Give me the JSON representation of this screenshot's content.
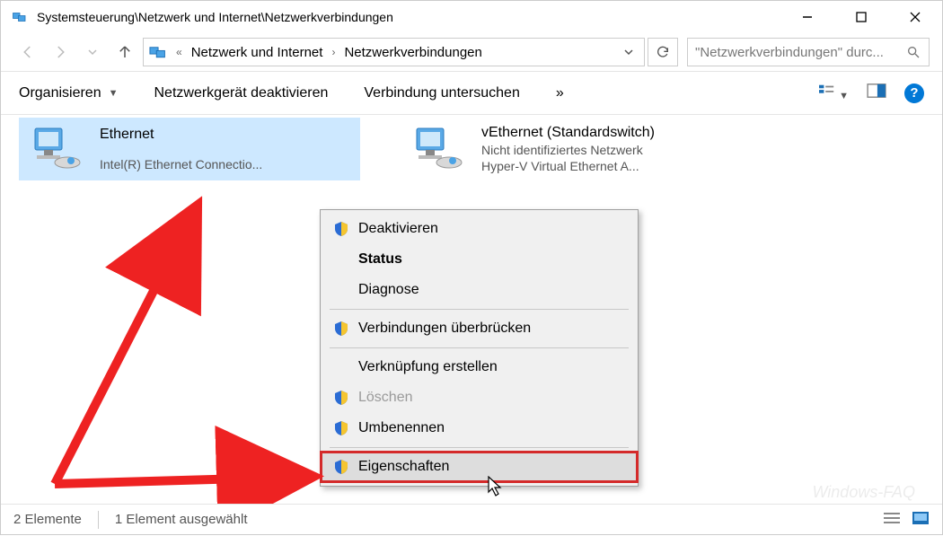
{
  "window": {
    "title": "Systemsteuerung\\Netzwerk und Internet\\Netzwerkverbindungen"
  },
  "breadcrumb": {
    "seg1": "Netzwerk und Internet",
    "seg2": "Netzwerkverbindungen"
  },
  "search": {
    "placeholder": "\"Netzwerkverbindungen\" durc..."
  },
  "toolbar": {
    "organize": "Organisieren",
    "disable_device": "Netzwerkgerät deaktivieren",
    "diagnose_conn": "Verbindung untersuchen"
  },
  "adapters": {
    "a": {
      "name": "Ethernet",
      "detail": "Intel(R) Ethernet Connectio..."
    },
    "b": {
      "name": "vEthernet (Standardswitch)",
      "status": "Nicht identifiziertes Netzwerk",
      "detail": "Hyper-V Virtual Ethernet A..."
    }
  },
  "ctx": {
    "deactivate": "Deaktivieren",
    "status": "Status",
    "diagnose": "Diagnose",
    "bridge": "Verbindungen überbrücken",
    "shortcut": "Verknüpfung erstellen",
    "delete": "Löschen",
    "rename": "Umbenennen",
    "properties": "Eigenschaften"
  },
  "statusbar": {
    "count": "2 Elemente",
    "selected": "1 Element ausgewählt"
  },
  "watermark": "Windows-FAQ"
}
